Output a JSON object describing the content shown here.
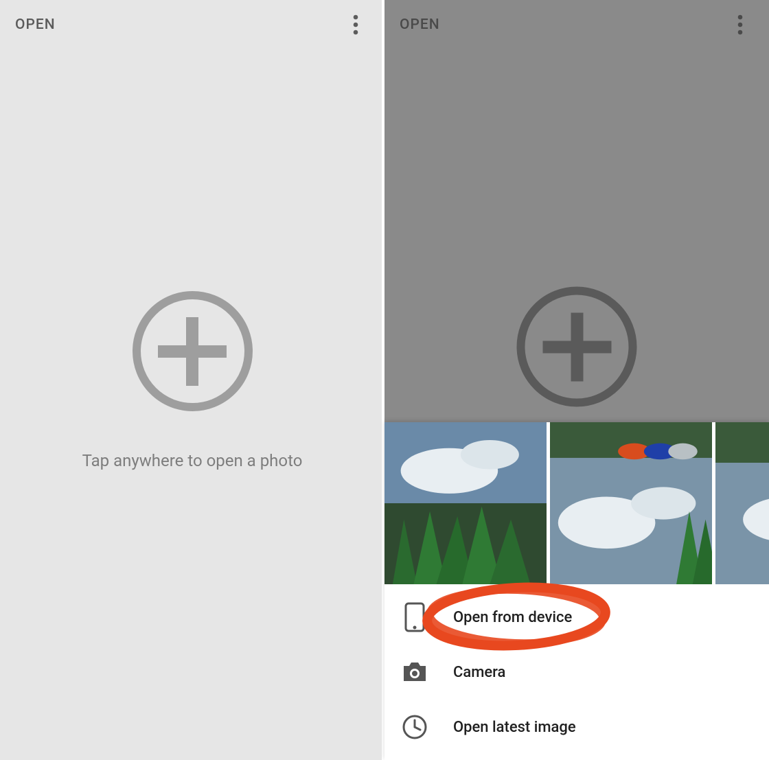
{
  "left": {
    "header_label": "OPEN",
    "hint": "Tap anywhere to open a photo"
  },
  "right": {
    "header_label": "OPEN",
    "menu": {
      "open_from_device": "Open from device",
      "camera": "Camera",
      "open_latest": "Open latest image"
    }
  }
}
